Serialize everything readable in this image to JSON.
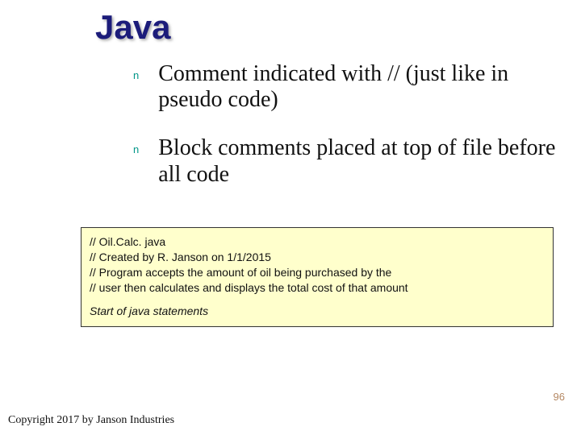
{
  "title": "Java",
  "bullets": [
    {
      "marker": "n",
      "text": "Comment indicated with // (just like in pseudo code)"
    },
    {
      "marker": "n",
      "text": "Block comments placed at top of file before all code"
    }
  ],
  "codebox": {
    "lines": [
      "// Oil.Calc. java",
      "// Created by R. Janson on 1/1/2015",
      "// Program accepts the amount of oil being purchased by the",
      "// user then calculates and displays the total cost of that amount"
    ],
    "startline": "Start of java statements"
  },
  "page_number": "96",
  "copyright": "Copyright 2017 by Janson Industries"
}
